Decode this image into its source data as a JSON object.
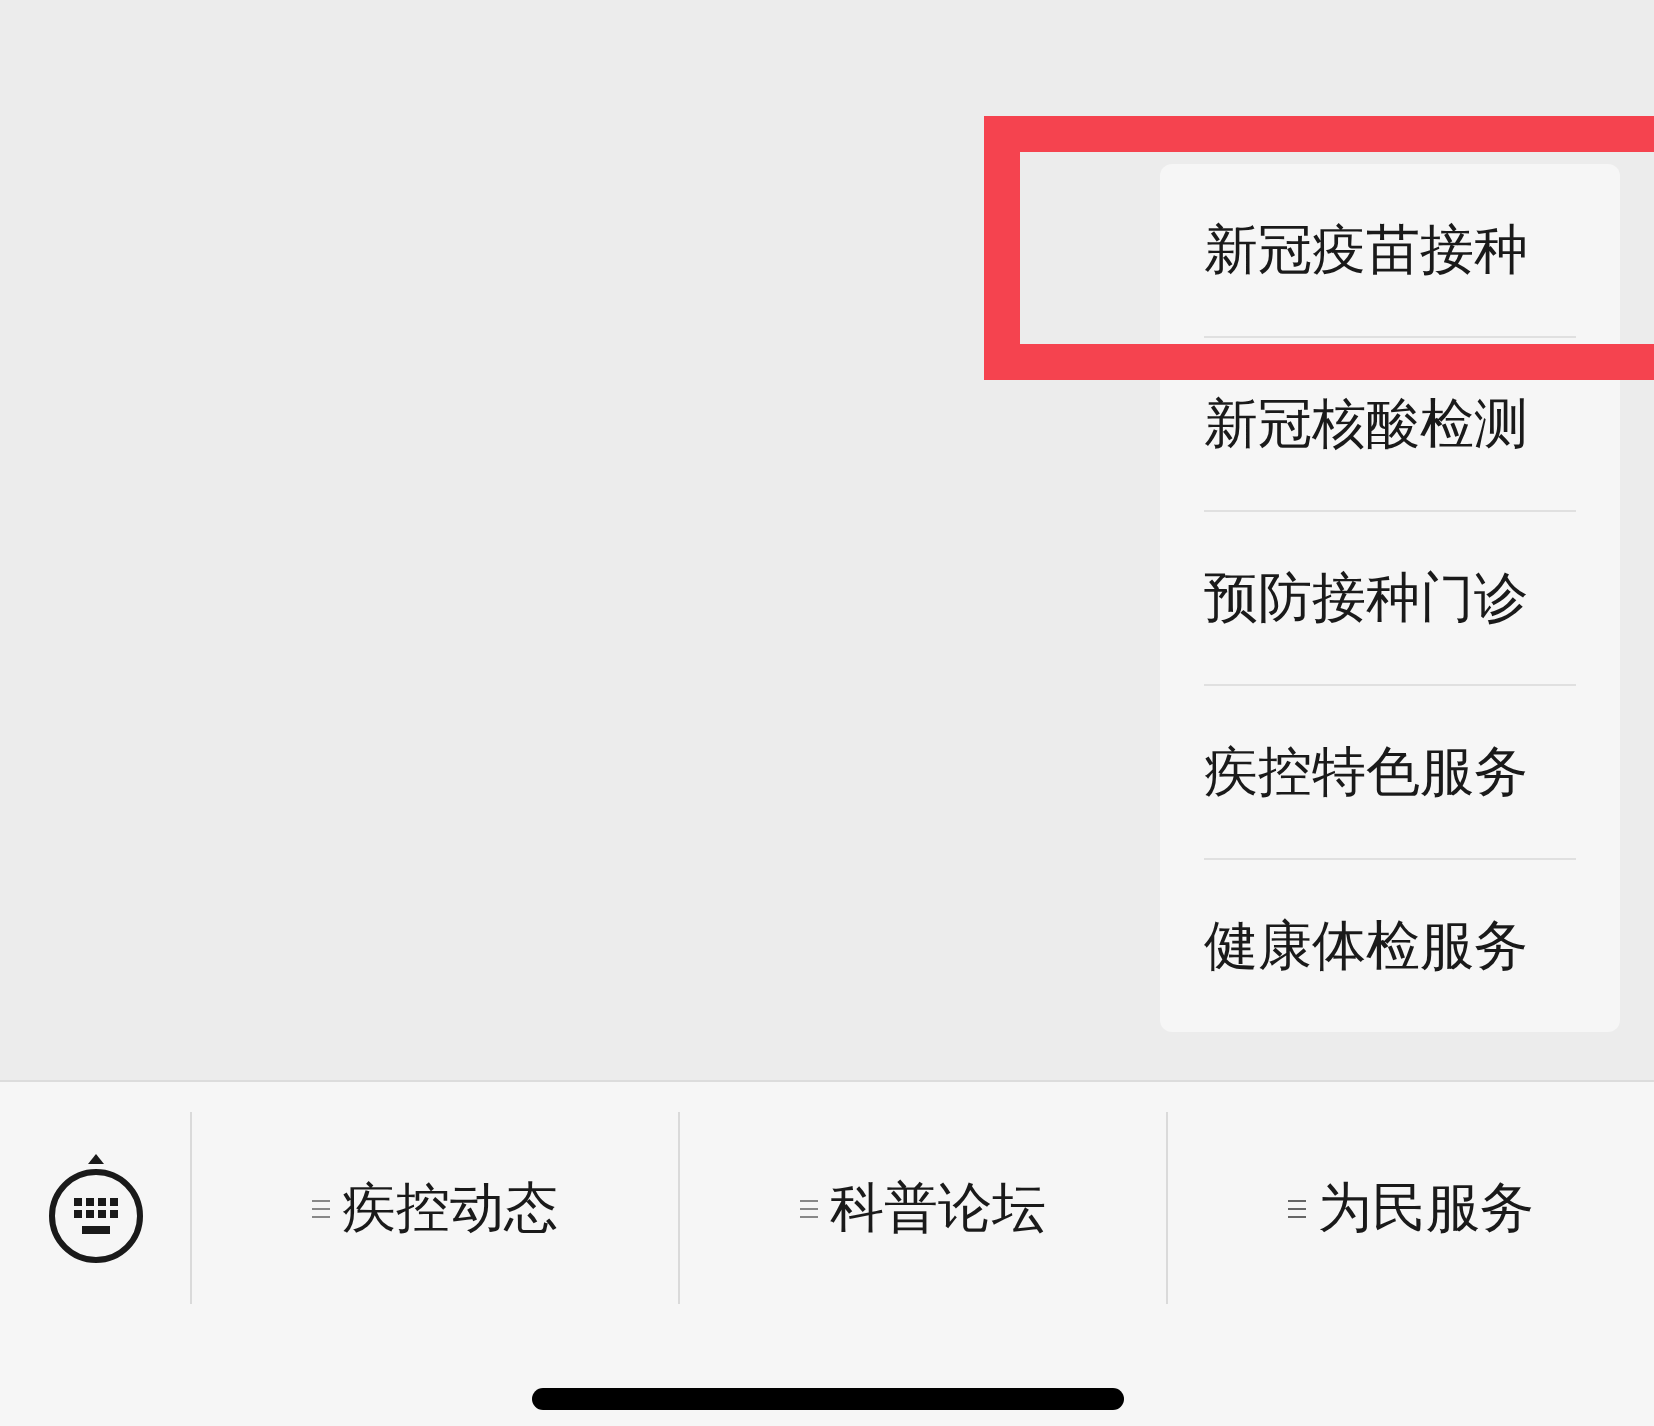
{
  "popup_menu": {
    "items": [
      {
        "label": "新冠疫苗接种",
        "highlighted": true
      },
      {
        "label": "新冠核酸检测",
        "highlighted": false
      },
      {
        "label": "预防接种门诊",
        "highlighted": false
      },
      {
        "label": "疾控特色服务",
        "highlighted": false
      },
      {
        "label": "健康体检服务",
        "highlighted": false
      }
    ]
  },
  "menu_bar": {
    "items": [
      {
        "label": "疾控动态",
        "expanded": false
      },
      {
        "label": "科普论坛",
        "expanded": false
      },
      {
        "label": "为民服务",
        "expanded": true
      }
    ]
  }
}
